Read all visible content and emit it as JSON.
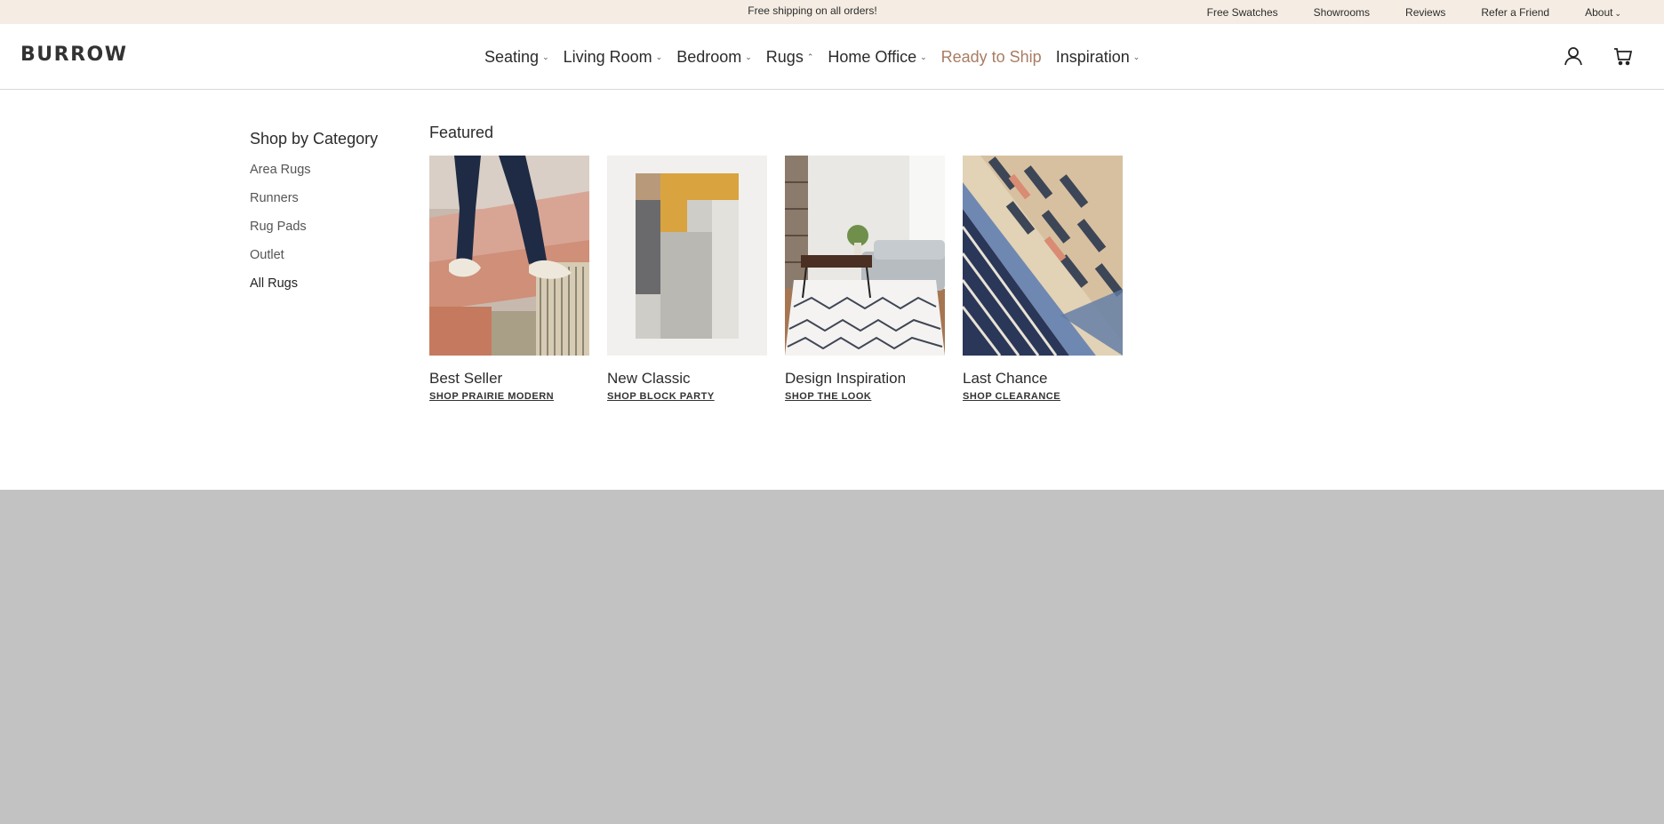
{
  "topbar": {
    "promo": "Free shipping on all orders!",
    "links": [
      "Free Swatches",
      "Showrooms",
      "Reviews",
      "Refer a Friend"
    ],
    "about": "About"
  },
  "brand": "BURROW",
  "nav": {
    "seating": "Seating",
    "living_room": "Living Room",
    "bedroom": "Bedroom",
    "rugs": "Rugs",
    "home_office": "Home Office",
    "ready_to_ship": "Ready to Ship",
    "inspiration": "Inspiration"
  },
  "icons": {
    "account": "user-icon",
    "cart": "cart-icon"
  },
  "colors": {
    "topbar_bg": "#f5ede3",
    "accent": "#a97c63",
    "overlay": "#c2c2c2"
  },
  "menu": {
    "category_title": "Shop by Category",
    "categories": [
      "Area Rugs",
      "Runners",
      "Rug Pads",
      "Outlet",
      "All Rugs"
    ],
    "featured_title": "Featured",
    "cards": [
      {
        "title": "Best Seller",
        "link": "SHOP PRAIRIE MODERN"
      },
      {
        "title": "New Classic",
        "link": "SHOP BLOCK PARTY"
      },
      {
        "title": "Design Inspiration",
        "link": "SHOP THE LOOK"
      },
      {
        "title": "Last Chance",
        "link": "SHOP CLEARANCE"
      }
    ]
  }
}
